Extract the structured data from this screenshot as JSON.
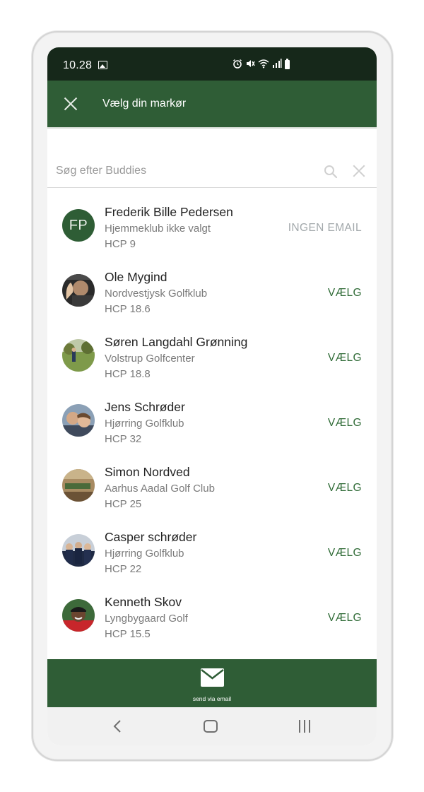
{
  "status_bar": {
    "time": "10.28",
    "icons": [
      "image-icon",
      "alarm-icon",
      "mute-icon",
      "wifi-icon",
      "signal-icon",
      "battery-icon"
    ]
  },
  "app_bar": {
    "title": "Vælg din markør",
    "close_icon": "close-icon"
  },
  "search": {
    "placeholder": "Søg efter Buddies",
    "value": ""
  },
  "buddies": [
    {
      "name": "Frederik Bille Pedersen",
      "club": "Hjemmeklub ikke valgt",
      "hcp": "HCP 9",
      "action": "INGEN EMAIL",
      "initials": "FP"
    },
    {
      "name": "Ole Mygind",
      "club": "Nordvestjysk Golfklub",
      "hcp": "HCP 18.6",
      "action": "VÆLG"
    },
    {
      "name": "Søren Langdahl Grønning",
      "club": "Volstrup Golfcenter",
      "hcp": "HCP 18.8",
      "action": "VÆLG"
    },
    {
      "name": "Jens Schrøder",
      "club": "Hjørring Golfklub",
      "hcp": "HCP 32",
      "action": "VÆLG"
    },
    {
      "name": "Simon Nordved",
      "club": "Aarhus Aadal Golf Club",
      "hcp": "HCP 25",
      "action": "VÆLG"
    },
    {
      "name": "Casper schrøder",
      "club": "Hjørring Golfklub",
      "hcp": "HCP 22",
      "action": "VÆLG"
    },
    {
      "name": "Kenneth Skov",
      "club": "Lyngbygaard Golf",
      "hcp": "HCP 15.5",
      "action": "VÆLG"
    }
  ],
  "bottom_bar": {
    "label": "send via email",
    "icon": "mail-icon"
  },
  "colors": {
    "status_bar": "#16281a",
    "primary_green": "#2f5d36",
    "action_green": "#2e6a35",
    "disabled_action": "#a2a8ab"
  }
}
